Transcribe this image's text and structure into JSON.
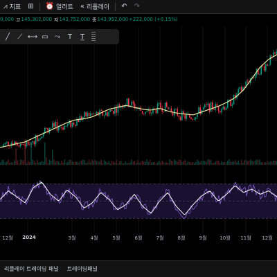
{
  "toolbar": {
    "indicators_label": "지표",
    "alert_label": "얼러트",
    "replay_label": "리플레이"
  },
  "legend": {
    "open_value": "0,000",
    "high_label": "고",
    "high_value": "145,302,000",
    "low_label": "저",
    "low_value": "143,752,000",
    "close_label": "종",
    "close_value": "143,992,000",
    "change": "+222,000 (+0.15%)"
  },
  "drawing_tools": [
    "line-tool-icon",
    "ray-tool-icon",
    "extended-line-tool-icon",
    "rectangle-tool-icon",
    "brush-tool-icon",
    "text-tool-icon",
    "price-label-tool-icon"
  ],
  "x_axis": {
    "labels": [
      "12월",
      "2024",
      "3월",
      "4월",
      "5월",
      "6월",
      "7월",
      "8월",
      "9월",
      "10월",
      "11월",
      "12월"
    ]
  },
  "bottom_bar": {
    "tabs": [
      "리플레이 트레이딩 패널",
      "트레이딩패널"
    ]
  },
  "colors": {
    "up": "#089981",
    "down": "#f23645",
    "ma": "#f0e6a0",
    "rsi": "#7e57c2",
    "rsi_ma": "#ffffff",
    "rsi_band": "#1a1030"
  },
  "chart_data": {
    "type": "candlestick",
    "panels": [
      "price",
      "volume",
      "rsi"
    ],
    "x_labels": [
      "12월",
      "2024",
      "3월",
      "4월",
      "5월",
      "6월",
      "7월",
      "8월",
      "9월",
      "10월",
      "11월",
      "12월"
    ],
    "price_ma_series": [
      58,
      60,
      62,
      64,
      68,
      72,
      76,
      80,
      84,
      87,
      88,
      90,
      94,
      98,
      100,
      102,
      100,
      98,
      97,
      99,
      96,
      94,
      93,
      92,
      95,
      98,
      101,
      105,
      110,
      118,
      130,
      142,
      150,
      155
    ],
    "rsi_series": [
      52,
      62,
      55,
      48,
      66,
      72,
      58,
      50,
      63,
      55,
      42,
      48,
      60,
      52,
      40,
      46,
      58,
      44,
      36,
      50,
      60,
      44,
      34,
      46,
      56,
      62,
      50,
      58,
      68,
      60,
      64,
      58,
      62,
      55
    ]
  }
}
